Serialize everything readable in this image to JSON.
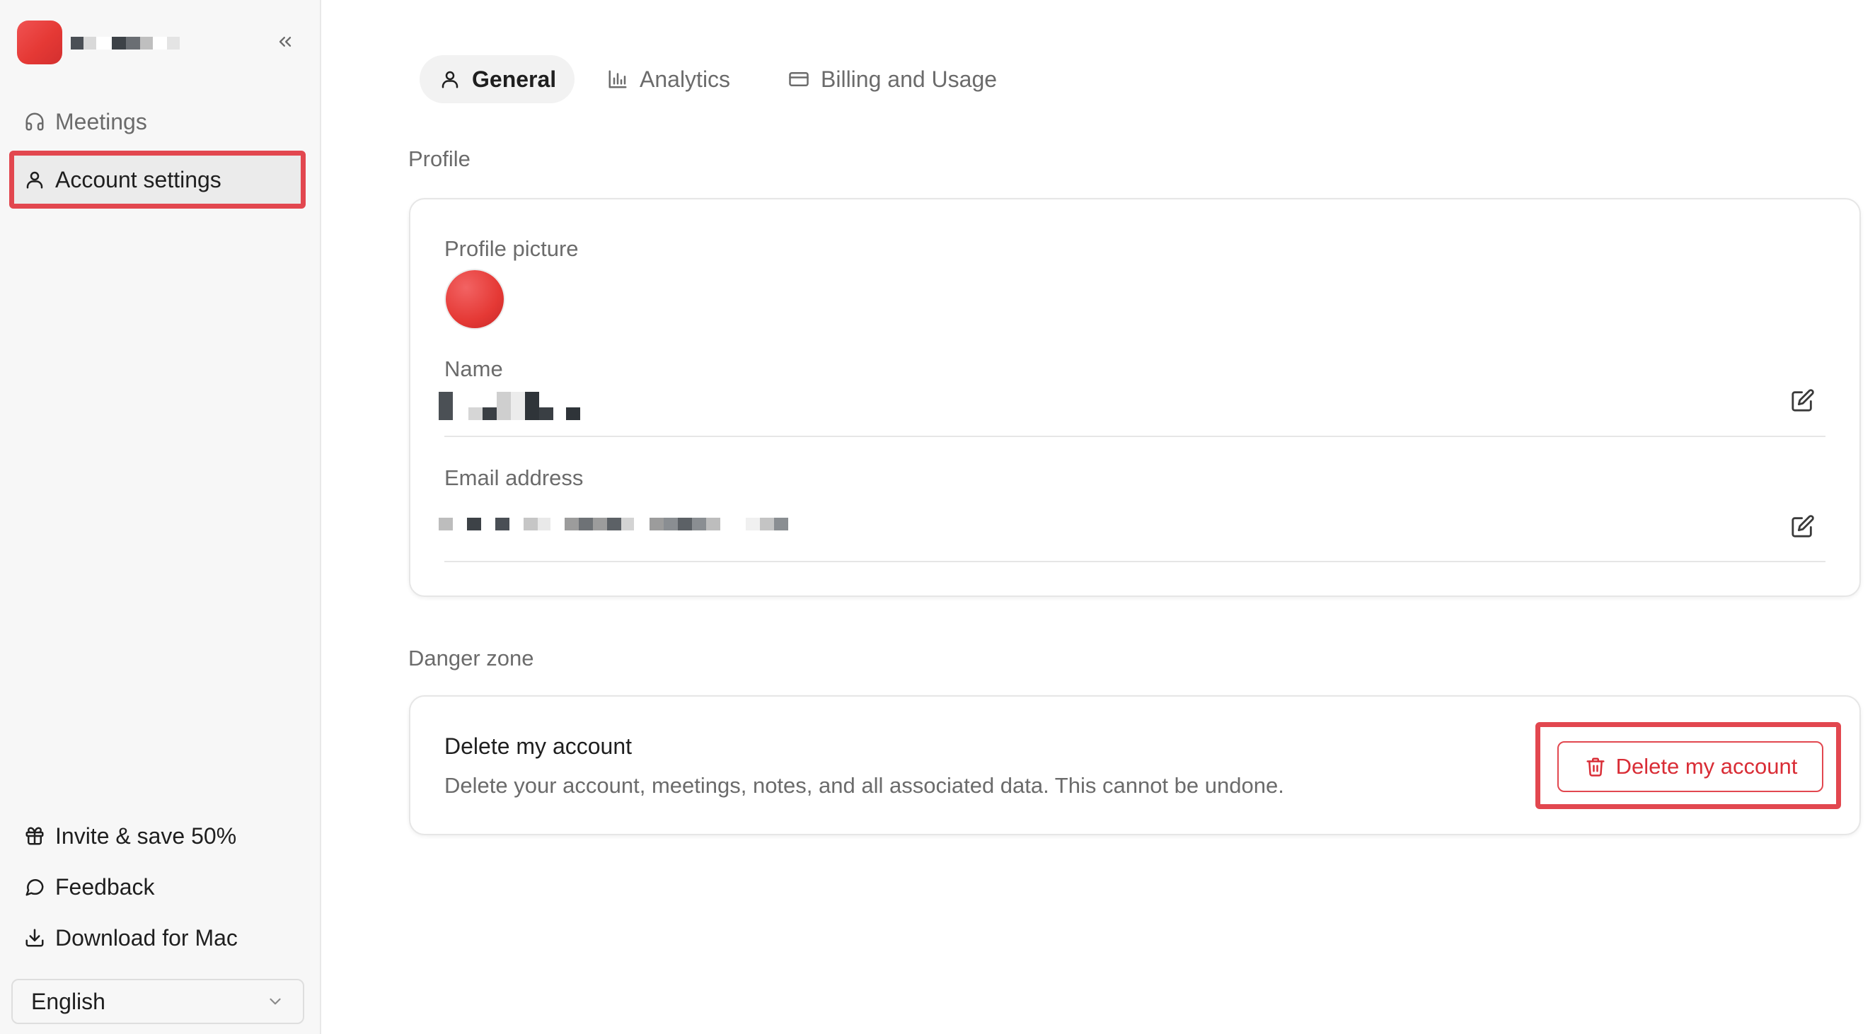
{
  "sidebar": {
    "nav": [
      {
        "label": "Meetings",
        "icon": "headphones-icon"
      },
      {
        "label": "Account settings",
        "icon": "user-icon"
      }
    ],
    "footer": [
      {
        "label": "Invite & save 50%",
        "icon": "gift-icon"
      },
      {
        "label": "Feedback",
        "icon": "message-circle-icon"
      },
      {
        "label": "Download for Mac",
        "icon": "download-icon"
      }
    ],
    "language": {
      "selected": "English"
    }
  },
  "tabs": [
    {
      "label": "General",
      "icon": "user-icon",
      "active": true
    },
    {
      "label": "Analytics",
      "icon": "bar-chart-icon",
      "active": false
    },
    {
      "label": "Billing and Usage",
      "icon": "credit-card-icon",
      "active": false
    }
  ],
  "profile": {
    "section_title": "Profile",
    "picture_label": "Profile picture",
    "name_label": "Name",
    "email_label": "Email address"
  },
  "danger": {
    "section_title": "Danger zone",
    "title": "Delete my account",
    "description": "Delete your account, meetings, notes, and all associated data. This cannot be undone.",
    "button_label": "Delete my account"
  },
  "colors": {
    "accent_red": "#e2474f",
    "danger_text": "#d92d36",
    "sidebar_bg": "#f7f7f7"
  }
}
